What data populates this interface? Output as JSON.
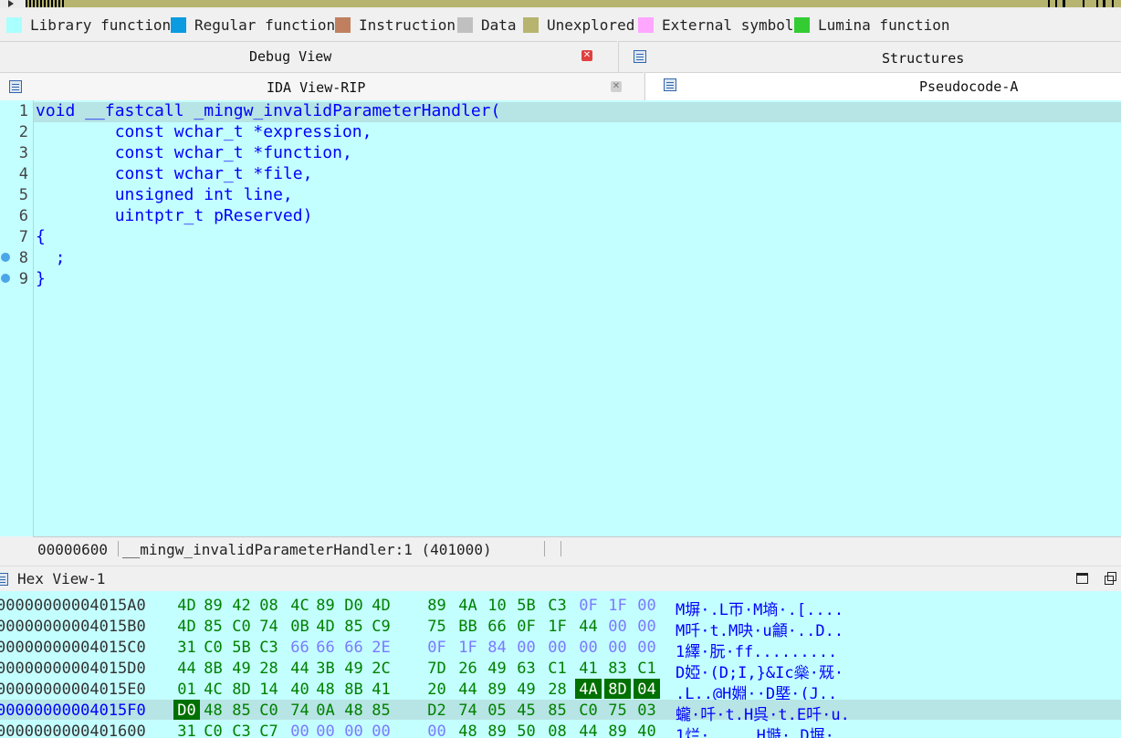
{
  "colors": {
    "library_function": "#aaffff",
    "regular_function": "#0a9be0",
    "instruction": "#c08060",
    "data": "#c0c0c0",
    "unexplored": "#b6b46e",
    "external_symbol": "#ffa6ff",
    "lumina_function": "#33cc33",
    "pseudocode_bg": "#c4ffff",
    "highlight_byte": "#007000"
  },
  "legend": [
    {
      "label": "Library function",
      "icon": "library-function-swatch"
    },
    {
      "label": "Regular function",
      "icon": "regular-function-swatch"
    },
    {
      "label": "Instruction",
      "icon": "instruction-swatch"
    },
    {
      "label": "Data",
      "icon": "data-swatch"
    },
    {
      "label": "Unexplored",
      "icon": "unexplored-swatch"
    },
    {
      "label": "External symbol",
      "icon": "external-symbol-swatch"
    },
    {
      "label": "Lumina function",
      "icon": "lumina-function-swatch"
    }
  ],
  "tabs": {
    "debug_view": "Debug View",
    "structures": "Structures",
    "ida_view": "IDA View-RIP",
    "pseudocode": "Pseudocode-A"
  },
  "code": {
    "lines": [
      {
        "num": "1",
        "text": "void __fastcall _mingw_invalidParameterHandler("
      },
      {
        "num": "2",
        "text": "        const wchar_t *expression,"
      },
      {
        "num": "3",
        "text": "        const wchar_t *function,"
      },
      {
        "num": "4",
        "text": "        const wchar_t *file,"
      },
      {
        "num": "5",
        "text": "        unsigned int line,"
      },
      {
        "num": "6",
        "text": "        uintptr_t pReserved)"
      },
      {
        "num": "7",
        "text": "{"
      },
      {
        "num": "8",
        "text": "  ;"
      },
      {
        "num": "9",
        "text": "}"
      }
    ]
  },
  "status": {
    "offset": "00000600",
    "location": "__mingw_invalidParameterHandler:1 (401000)"
  },
  "hex_view": {
    "title": "Hex View-1",
    "rows": [
      {
        "addr": "00000000004015A0",
        "bytes": [
          "4D",
          "89",
          "42",
          "08",
          "4C",
          "89",
          "D0",
          "4D",
          "89",
          "4A",
          "10",
          "5B",
          "C3",
          "0F",
          "1F",
          "00"
        ],
        "ascii": "M塀·.L帀·M墒·.[...."
      },
      {
        "addr": "00000000004015B0",
        "bytes": [
          "4D",
          "85",
          "C0",
          "74",
          "0B",
          "4D",
          "85",
          "C9",
          "75",
          "BB",
          "66",
          "0F",
          "1F",
          "44",
          "00",
          "00"
        ],
        "ascii": "M吀·t.M吷·u龥·..D.."
      },
      {
        "addr": "00000000004015C0",
        "bytes": [
          "31",
          "C0",
          "5B",
          "C3",
          "66",
          "66",
          "66",
          "2E",
          "0F",
          "1F",
          "84",
          "00",
          "00",
          "00",
          "00",
          "00"
        ],
        "ascii": "1繹·朊·ff........."
      },
      {
        "addr": "00000000004015D0",
        "bytes": [
          "44",
          "8B",
          "49",
          "28",
          "44",
          "3B",
          "49",
          "2C",
          "7D",
          "26",
          "49",
          "63",
          "C1",
          "41",
          "83",
          "C1"
        ],
        "ascii": "D婭·(D;I,}&Ic橤·兓·"
      },
      {
        "addr": "00000000004015E0",
        "bytes": [
          "01",
          "4C",
          "8D",
          "14",
          "40",
          "48",
          "8B",
          "41",
          "20",
          "44",
          "89",
          "49",
          "28",
          "4A",
          "8D",
          "04"
        ],
        "ascii": ".L..@H婣··D塈·(J.."
      },
      {
        "addr": "00000000004015F0",
        "bytes": [
          "D0",
          "48",
          "85",
          "C0",
          "74",
          "0A",
          "48",
          "85",
          "D2",
          "74",
          "05",
          "45",
          "85",
          "C0",
          "75",
          "03"
        ],
        "ascii": "蠬·吀·t.H呉·t.E吀·u."
      },
      {
        "addr": "0000000000401600",
        "bytes": [
          "31",
          "C0",
          "C3",
          "C7",
          "00",
          "00",
          "00",
          "00",
          "00",
          "48",
          "89",
          "50",
          "08",
          "44",
          "89",
          "40"
        ],
        "ascii": "1烂·.....H塒·.D塀·"
      }
    ]
  }
}
